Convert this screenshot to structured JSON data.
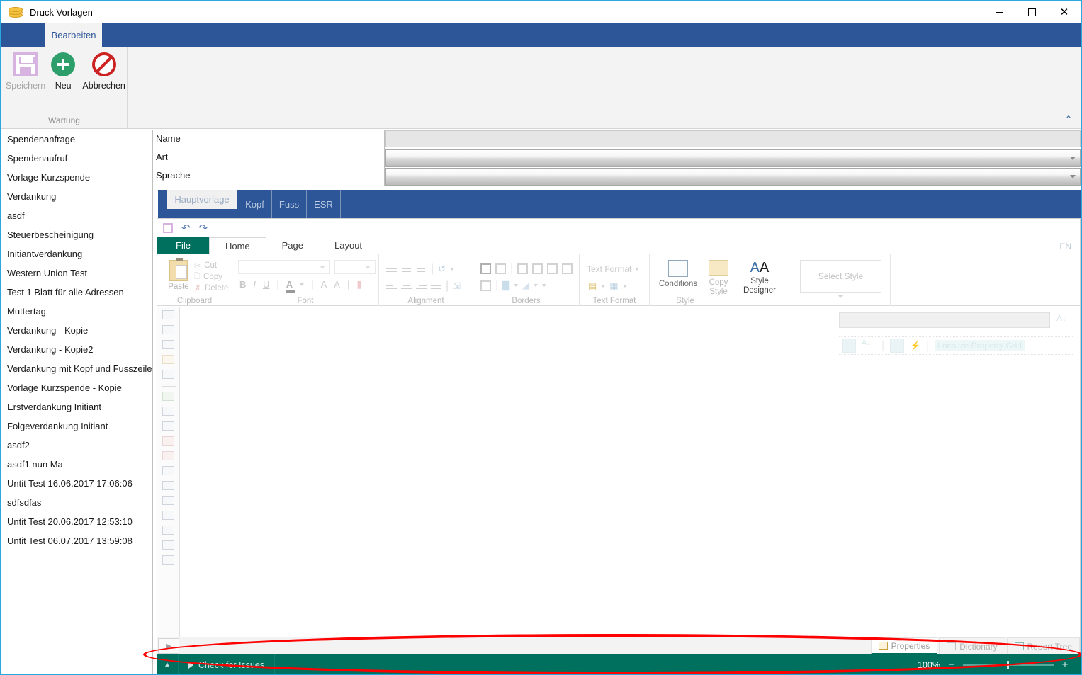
{
  "window": {
    "title": "Druck Vorlagen",
    "icon": "coins-icon",
    "minimize": "—",
    "maximize": "☐",
    "close": "✕"
  },
  "outer_ribbon": {
    "tab": "Bearbeiten",
    "group_label": "Wartung",
    "collapse_glyph": "⌃",
    "buttons": [
      {
        "label": "Speichern",
        "icon": "save-icon",
        "enabled": false
      },
      {
        "label": "Neu",
        "icon": "plus-circle-icon",
        "enabled": true
      },
      {
        "label": "Abbrechen",
        "icon": "cancel-circle-icon",
        "enabled": true
      }
    ]
  },
  "template_list": {
    "items": [
      "Spendenanfrage",
      "Spendenaufruf",
      "Vorlage Kurzspende",
      "Verdankung",
      "asdf",
      "Steuerbescheinigung",
      "Initiantverdankung",
      "Western Union Test",
      "Test 1 Blatt für alle Adressen",
      "Muttertag",
      "Verdankung - Kopie",
      "Verdankung - Kopie2",
      "Verdankung mit Kopf und Fusszeile DE",
      "Vorlage Kurzspende - Kopie",
      "Erstverdankung Initiant",
      "Folgeverdankung Initiant",
      "asdf2",
      "asdf1 nun Ma",
      "Untit Test 16.06.2017 17:06:06",
      "sdfsdfas",
      "Untit Test 20.06.2017 12:53:10",
      "Untit Test 06.07.2017 13:59:08"
    ]
  },
  "form": {
    "labels": [
      "Name",
      "Art",
      "Sprache"
    ],
    "name_value": "",
    "art_value": "",
    "sprache_value": ""
  },
  "sub_tabs": [
    {
      "label": "Hauptvorlage",
      "active": true
    },
    {
      "label": "Kopf",
      "active": false
    },
    {
      "label": "Fuss",
      "active": false
    },
    {
      "label": "ESR",
      "active": false
    }
  ],
  "designer": {
    "quick_access": {
      "save": "save-icon",
      "undo": "↶",
      "redo": "↷"
    },
    "tabs": [
      {
        "label": "File",
        "kind": "file"
      },
      {
        "label": "Home",
        "kind": "active"
      },
      {
        "label": "Page",
        "kind": "normal"
      },
      {
        "label": "Layout",
        "kind": "normal"
      }
    ],
    "language_badge": "EN",
    "groups": [
      {
        "name": "Clipboard",
        "label": "Clipboard",
        "paste_label": "Paste",
        "items": [
          "Cut",
          "Copy",
          "Delete"
        ]
      },
      {
        "name": "Font",
        "label": "Font",
        "font_family_value": "",
        "font_size_value": "",
        "bold": "B",
        "italic": "I",
        "underline": "U",
        "font_color": "A",
        "grow_font": "A",
        "shrink_font": "A",
        "clear_format": "eraser-icon"
      },
      {
        "name": "Alignment",
        "label": "Alignment"
      },
      {
        "name": "Borders",
        "label": "Borders"
      },
      {
        "name": "TextFormat",
        "label": "Text Format",
        "button_label": "Text Format"
      },
      {
        "name": "Style",
        "label": "Style",
        "conditions_label": "Conditions",
        "copy_style_label": "Copy Style",
        "style_designer_label": "Style Designer",
        "select_style_label": "Select Style"
      }
    ]
  },
  "properties_panel": {
    "selector_value": "",
    "sort_icon": "sort-az-icon",
    "toolbar_buttons": [
      "categorized-icon",
      "sort-az-icon",
      "property-pages-icon",
      "events-icon"
    ],
    "localize_label": "Localize Property Grid"
  },
  "bottom_tabs": [
    {
      "label": "Properties",
      "icon": "properties-icon",
      "active": true
    },
    {
      "label": "Dictionary",
      "icon": "dictionary-icon",
      "active": false
    },
    {
      "label": "Report Tree",
      "icon": "report-tree-icon",
      "active": false
    }
  ],
  "status_bar": {
    "expand_glyph": "▲",
    "check_for_issues": "Check for Issues",
    "zoom_level": "100%",
    "zoom_out": "−",
    "zoom_in": "+"
  },
  "colors": {
    "title_blue": "#2c5697",
    "accent_teal": "#00705e",
    "annotation_red": "#ff0000",
    "window_border": "#29a8e0",
    "ribbon_bg": "#f3f3f3"
  }
}
